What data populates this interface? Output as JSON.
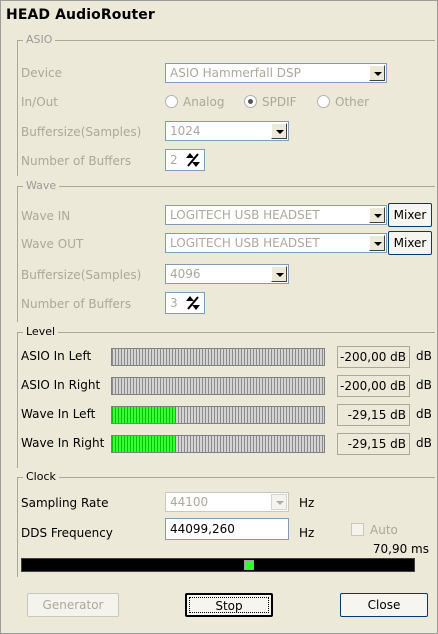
{
  "window": {
    "title": "HEAD AudioRouter"
  },
  "asio": {
    "group_label": "ASIO",
    "device_label": "Device",
    "device_value": "ASIO Hammerfall DSP",
    "inout_label": "In/Out",
    "inout_options": [
      "Analog",
      "SPDIF",
      "Other"
    ],
    "inout_selected": "SPDIF",
    "buffersize_label": "Buffersize(Samples)",
    "buffersize_value": "1024",
    "buffers_label": "Number of Buffers",
    "buffers_value": "2"
  },
  "wave": {
    "group_label": "Wave",
    "in_label": "Wave IN",
    "in_value": "LOGITECH USB HEADSET",
    "out_label": "Wave OUT",
    "out_value": "LOGITECH USB HEADSET",
    "mixer_label": "Mixer",
    "buffersize_label": "Buffersize(Samples)",
    "buffersize_value": "4096",
    "buffers_label": "Number of Buffers",
    "buffers_value": "3"
  },
  "level": {
    "group_label": "Level",
    "unit": "dB",
    "rows": [
      {
        "label": "ASIO In Left",
        "value": "-200,00 dB",
        "fill": 0.0
      },
      {
        "label": "ASIO In Right",
        "value": "-200,00 dB",
        "fill": 0.0
      },
      {
        "label": "Wave In Left",
        "value": "-29,15 dB",
        "fill": 0.3
      },
      {
        "label": "Wave In Right",
        "value": "-29,15 dB",
        "fill": 0.3
      }
    ]
  },
  "clock": {
    "group_label": "Clock",
    "sampling_label": "Sampling Rate",
    "sampling_value": "44100",
    "dds_label": "DDS Frequency",
    "dds_value": "44099,260",
    "hz": "Hz",
    "auto_label": "Auto",
    "ms_value": "70,90 ms",
    "slider_position": 0.58
  },
  "buttons": {
    "generator": "Generator",
    "stop": "Stop",
    "close": "Close"
  },
  "colors": {
    "meter_green": "#33ff33",
    "background": "#ece9d8"
  }
}
